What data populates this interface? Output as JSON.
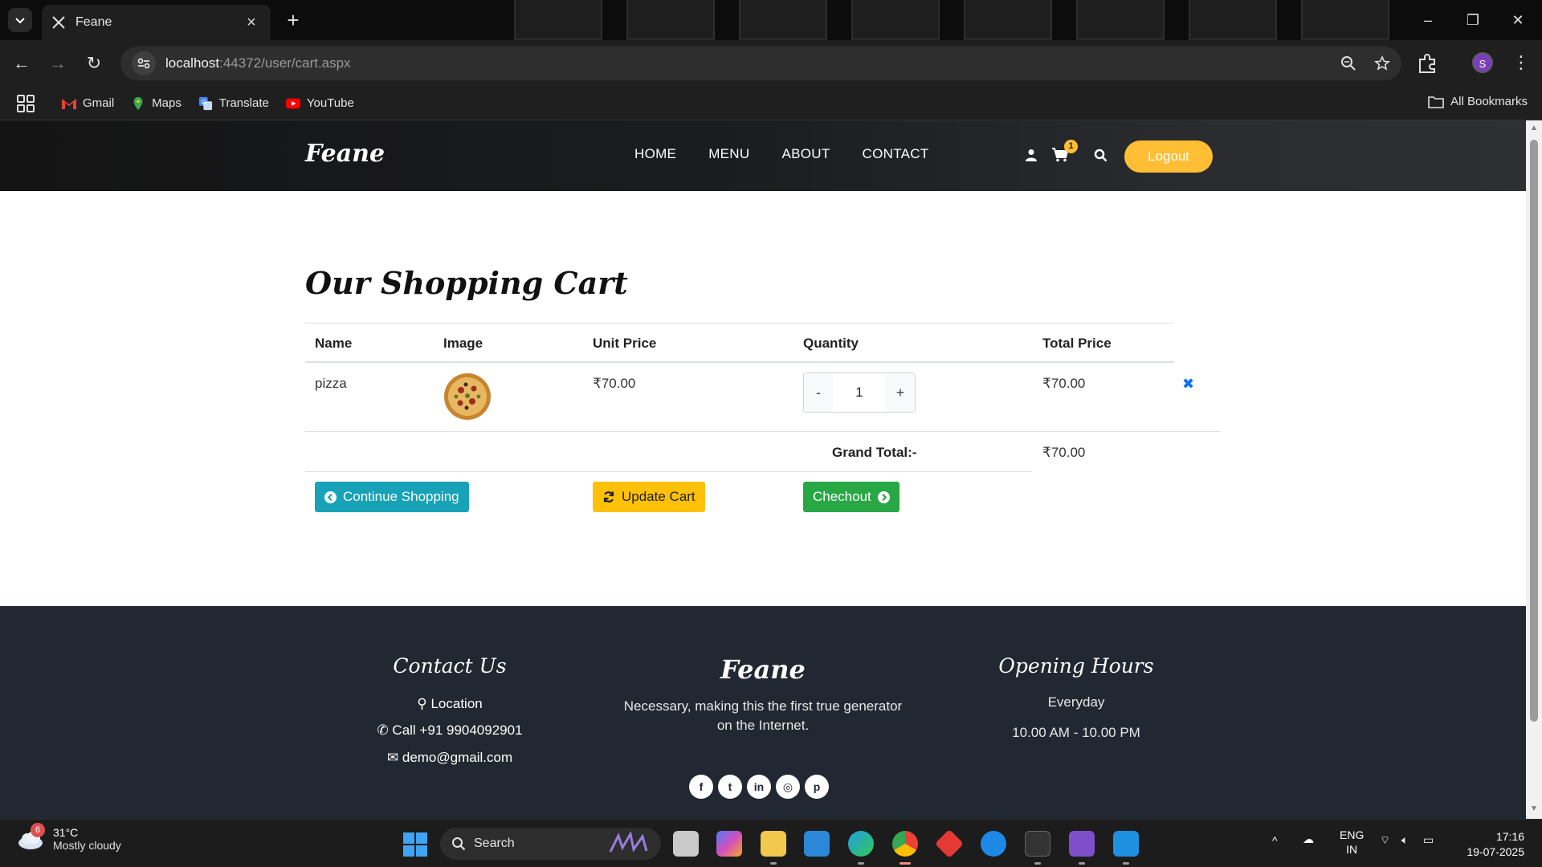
{
  "browser": {
    "tab_title": "Feane",
    "url_host": "localhost",
    "url_rest": ":44372/user/cart.aspx",
    "profile_initial": "S",
    "bookmarks": [
      {
        "label": "Gmail",
        "icon": "gmail-icon",
        "color": "#ea4335"
      },
      {
        "label": "Maps",
        "icon": "maps-icon",
        "color": "#34a853"
      },
      {
        "label": "Translate",
        "icon": "translate-icon",
        "color": "#4285f4"
      },
      {
        "label": "YouTube",
        "icon": "youtube-icon",
        "color": "#ff0000"
      }
    ],
    "all_bookmarks": "All Bookmarks"
  },
  "site": {
    "brand": "Feane",
    "nav": [
      "HOME",
      "MENU",
      "ABOUT",
      "CONTACT"
    ],
    "cart_count": "1",
    "logout": "Logout",
    "accent": "#ffbe33"
  },
  "cart": {
    "title": "Our Shopping Cart",
    "headers": {
      "name": "Name",
      "image": "Image",
      "unit_price": "Unit Price",
      "quantity": "Quantity",
      "total_price": "Total Price"
    },
    "items": [
      {
        "name": "pizza",
        "unit_price": "₹70.00",
        "quantity": "1",
        "total_price": "₹70.00"
      }
    ],
    "qty_minus": "-",
    "qty_plus": "+",
    "grand_total_label": "Grand Total:-",
    "grand_total_value": "₹70.00",
    "buttons": {
      "continue": "Continue Shopping",
      "update": "Update Cart",
      "checkout": "Chechout"
    }
  },
  "footer": {
    "contact_heading": "Contact Us",
    "location": "Location",
    "phone": "Call +91 9904092901",
    "email": "demo@gmail.com",
    "brand": "Feane",
    "tagline_1": "Necessary, making this the first true generator",
    "tagline_2": "on the Internet.",
    "socials": [
      "facebook-icon",
      "twitter-icon",
      "linkedin-icon",
      "instagram-icon",
      "pinterest-icon"
    ],
    "hours_heading": "Opening Hours",
    "hours_days": "Everyday",
    "hours_time": "10.00 AM - 10.00 PM"
  },
  "taskbar": {
    "weather_badge": "6",
    "temperature": "31°C",
    "weather_desc": "Mostly cloudy",
    "search_label": "Search",
    "lang_1": "ENG",
    "lang_2": "IN",
    "time": "17:16",
    "date": "19-07-2025"
  }
}
